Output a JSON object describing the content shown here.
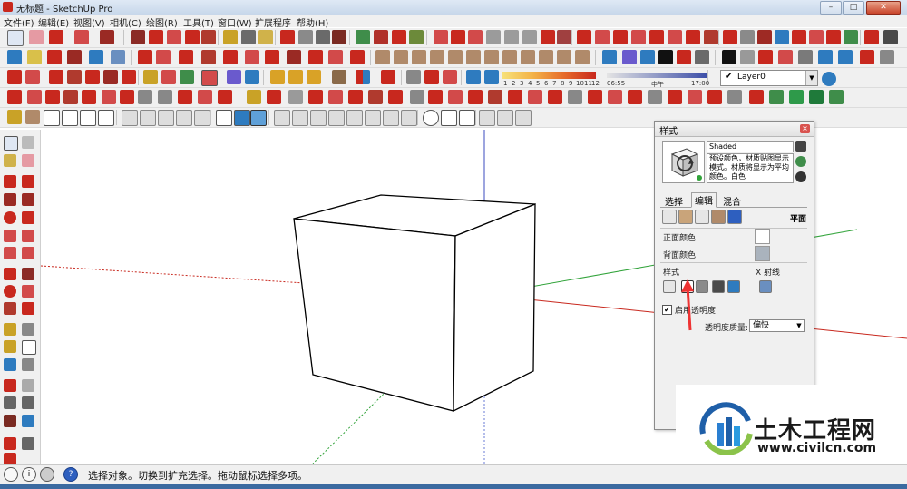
{
  "window": {
    "title": "无标题 - SketchUp Pro",
    "minimize": "–",
    "maximize": "□",
    "close": "✕"
  },
  "menu": [
    "文件(F)",
    "编辑(E)",
    "视图(V)",
    "相机(C)",
    "绘图(R)",
    "工具(T)",
    "窗口(W)",
    "扩展程序",
    "帮助(H)"
  ],
  "toolbars": {
    "layer_label": "Layer0",
    "layer_checked": "✔",
    "month_scale": [
      "1",
      "2",
      "3",
      "4",
      "5",
      "6",
      "7",
      "8",
      "9",
      "10",
      "11",
      "12"
    ],
    "time_left": "06:55",
    "time_mid": "中午",
    "time_right": "17:00"
  },
  "statusbar": {
    "help_icon": "?",
    "info_icon": "i",
    "message": "选择对象。切换到扩充选择。拖动鼠标选择多项。"
  },
  "styles_panel": {
    "title": "样式",
    "close": "×",
    "style_name": "Shaded",
    "description": "预设颜色，材质贴图显示模式。材质将显示为平均颜色。白色",
    "tabs": [
      "选择",
      "编辑",
      "混合"
    ],
    "active_tab": "编辑",
    "face_heading": "平面",
    "front_color_label": "正面颜色",
    "back_color_label": "背面颜色",
    "style_section": "样式",
    "xray_label": "X 射线",
    "transparency_checkbox": "✔",
    "transparency_label": "启用透明度",
    "quality_label": "透明度质量:",
    "quality_value": "偏快",
    "colors": {
      "front": "#ffffff",
      "back": "#aab3bd"
    }
  },
  "watermark": {
    "name": "土木工程网",
    "url": "www.civilcn.com"
  }
}
